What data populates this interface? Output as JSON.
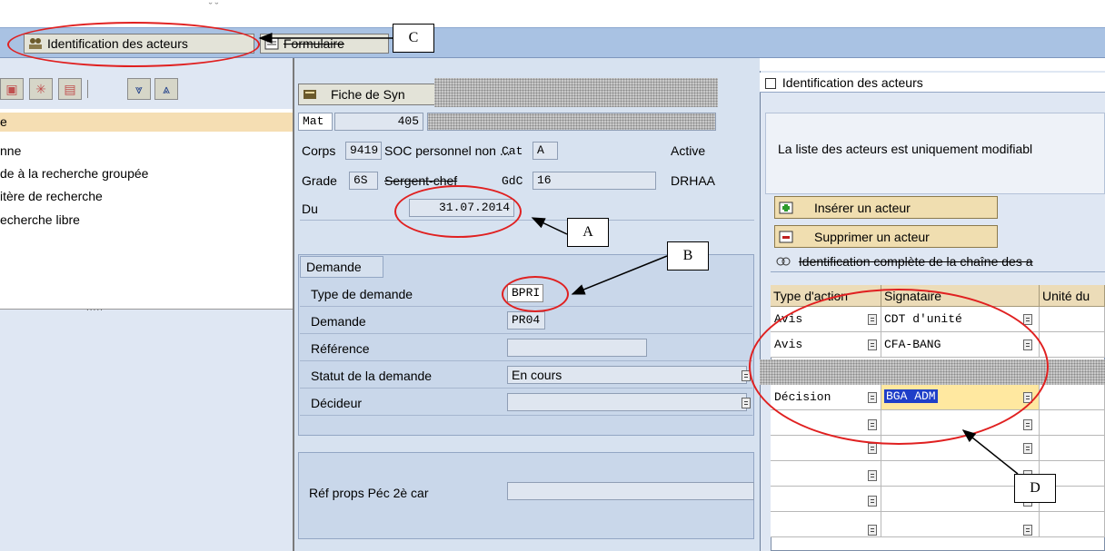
{
  "toolbar": {
    "identification_label": "Identification des acteurs",
    "formulaire_label": "Formulaire"
  },
  "left_list": {
    "items": [
      "e",
      "nne",
      "de à la recherche groupée",
      "itère de recherche",
      "echerche libre"
    ]
  },
  "fiche": {
    "button_label": "Fiche de Syn",
    "mat_label": "Mat",
    "mat_value": "405",
    "corps_label": "Corps",
    "corps_value": "9419",
    "corps_text": "SOC personnel non ...",
    "cat_label": "Cat",
    "cat_value": "A",
    "active_text": "Active",
    "grade_label": "Grade",
    "grade_value": "6S",
    "grade_text": "Sergent-chef",
    "gdc_label": "GdC",
    "gdc_value": "16",
    "drhaa_text": "DRHAA",
    "du_label": "Du",
    "du_value": "31.07.2014"
  },
  "demande": {
    "tab_label": "Demande",
    "rows": [
      {
        "label": "Type de demande",
        "value": "BPRI"
      },
      {
        "label": "Demande",
        "value": "PR04"
      },
      {
        "label": "Référence",
        "value": ""
      },
      {
        "label": "Statut de la demande",
        "value": "En cours"
      },
      {
        "label": "Décideur",
        "value": ""
      }
    ],
    "ref_label": "Réf props Péc 2è car"
  },
  "right_panel": {
    "title": "Identification des acteurs",
    "info_text": "La liste des acteurs est uniquement modifiabl",
    "insert_button": "Insérer un  acteur",
    "delete_button": "Supprimer un acteur",
    "table_title": "Identification complète de la chaîne des a",
    "columns": [
      "Type d'action",
      "Signataire",
      "Unité du"
    ],
    "rows": [
      {
        "type": "Avis",
        "signataire": "CDT d'unité"
      },
      {
        "type": "Avis",
        "signataire": "CFA-BANG"
      },
      {
        "type": "Décision",
        "signataire": "BGA ADM"
      }
    ]
  },
  "annotations": {
    "a": "A",
    "b": "B",
    "c": "C",
    "d": "D"
  },
  "colors": {
    "toolbar_bg": "#a9c2e3",
    "pane_bg": "#d7e2f0",
    "highlight": "#f5deb3",
    "annotation_red": "#e02020",
    "selected_cell": "#ffe8a0"
  }
}
